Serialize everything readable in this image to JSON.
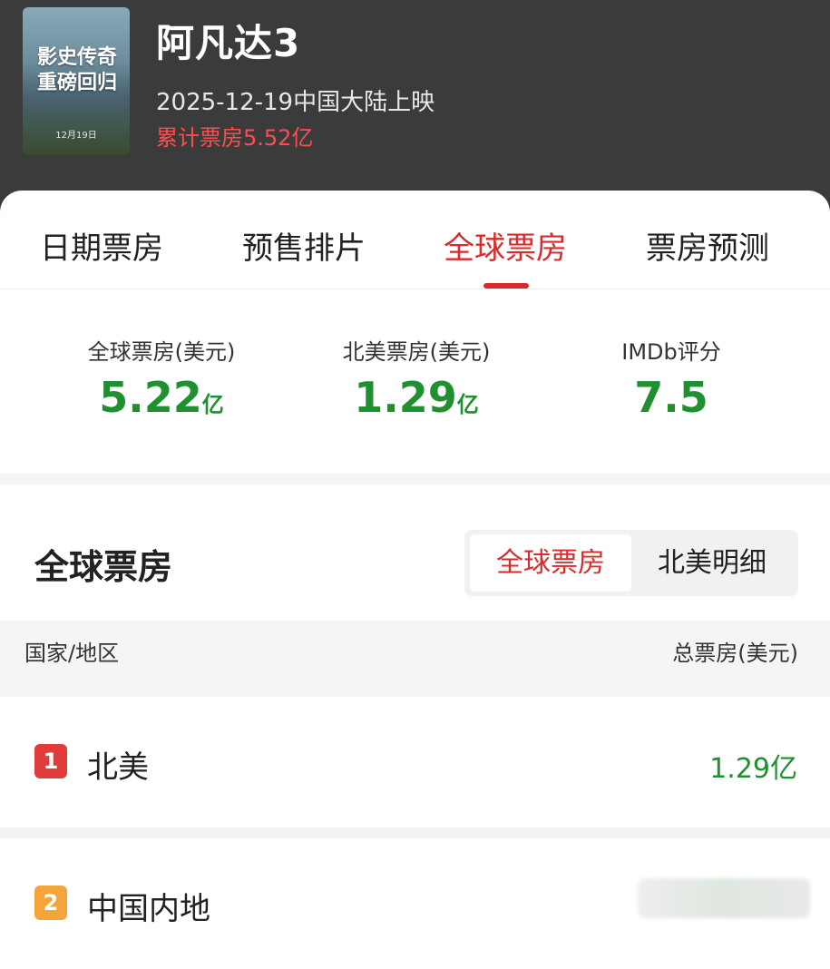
{
  "header": {
    "poster": {
      "tagline_line1": "影史传奇",
      "tagline_line2": "重磅回归",
      "date_text": "12月19日"
    },
    "title": "阿凡达3",
    "release": "2025-12-19中国大陆上映",
    "cumulative_box_office": "累计票房5.52亿"
  },
  "tabs": [
    {
      "label": "日期票房",
      "active": false
    },
    {
      "label": "预售排片",
      "active": false
    },
    {
      "label": "全球票房",
      "active": true
    },
    {
      "label": "票房预测",
      "active": false
    }
  ],
  "stats": [
    {
      "label": "全球票房(美元)",
      "value": "5.22",
      "unit": "亿"
    },
    {
      "label": "北美票房(美元)",
      "value": "1.29",
      "unit": "亿"
    },
    {
      "label": "IMDb评分",
      "value": "7.5",
      "unit": ""
    }
  ],
  "section": {
    "title": "全球票房",
    "segments": [
      "全球票房",
      "北美明细"
    ],
    "active_segment": "全球票房"
  },
  "table": {
    "col_left": "国家/地区",
    "col_right": "总票房(美元)",
    "rows": [
      {
        "rank": "1",
        "region": "北美",
        "total": "1.29亿"
      },
      {
        "rank": "2",
        "region": "中国内地",
        "total": ""
      }
    ]
  },
  "colors": {
    "header_bg": "#3b3b3b",
    "accent_red": "#d92b2b",
    "value_green": "#1f8f2f",
    "rank1": "#e23b3b",
    "rank2": "#f4a53a"
  }
}
